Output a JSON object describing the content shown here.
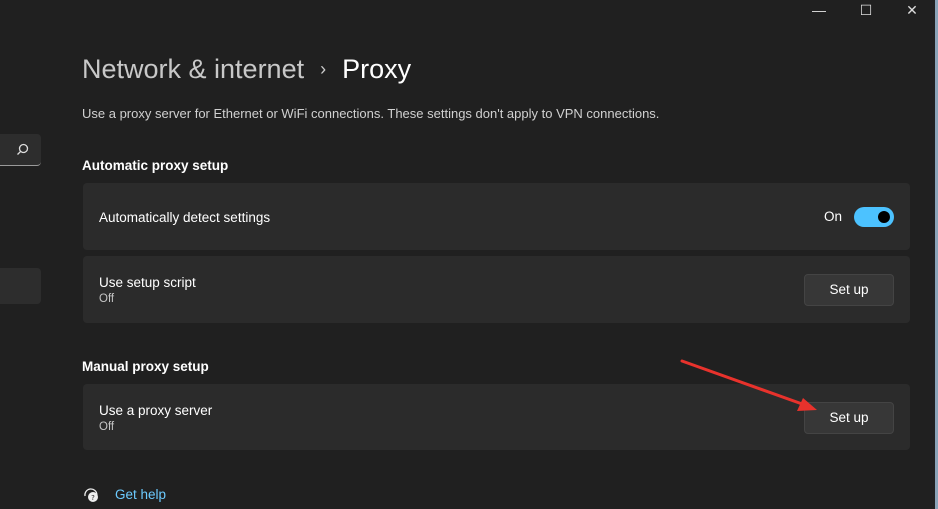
{
  "window": {
    "minimize": "—",
    "maximize": "☐",
    "close": "✕"
  },
  "breadcrumb": {
    "parent": "Network & internet",
    "separator": "›",
    "current": "Proxy"
  },
  "description": "Use a proxy server for Ethernet or WiFi connections. These settings don't apply to VPN connections.",
  "automatic": {
    "heading": "Automatic proxy setup",
    "detect": {
      "title": "Automatically detect settings",
      "state": "On",
      "enabled": true
    },
    "script": {
      "title": "Use setup script",
      "status": "Off",
      "button": "Set up"
    }
  },
  "manual": {
    "heading": "Manual proxy setup",
    "proxy": {
      "title": "Use a proxy server",
      "status": "Off",
      "button": "Set up"
    }
  },
  "help": {
    "label": "Get help"
  },
  "colors": {
    "accent": "#4cc2ff",
    "annotation_arrow": "#e8322c",
    "link": "#6ccbff"
  }
}
